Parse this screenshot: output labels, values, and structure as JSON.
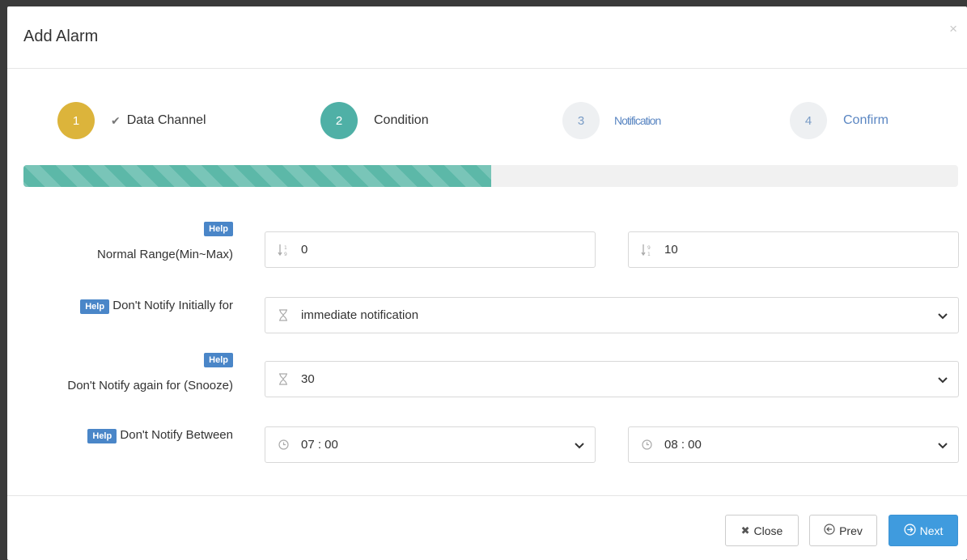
{
  "modal": {
    "title": "Add Alarm",
    "close_glyph": "×"
  },
  "steps": [
    {
      "number": "1",
      "label": "Data Channel",
      "state": "done",
      "color": "#dcb43b",
      "check": "✔"
    },
    {
      "number": "2",
      "label": "Condition",
      "state": "active",
      "color": "#4fb0a6"
    },
    {
      "number": "3",
      "label": "Notification",
      "state": "inactive"
    },
    {
      "number": "4",
      "label": "Confirm",
      "state": "inactive"
    }
  ],
  "progress": {
    "percent": 50,
    "color": "#5cb8a8"
  },
  "form": {
    "help_label": "Help",
    "normal_range": {
      "label": "Normal Range(Min~Max)",
      "min_value": "0",
      "min_icon": "sort-numeric-asc-icon",
      "max_value": "10",
      "max_icon": "sort-numeric-desc-icon"
    },
    "initial_delay": {
      "label": "Don't Notify Initially for",
      "value": "immediate notification",
      "icon": "hourglass-icon"
    },
    "snooze": {
      "label": "Don't Notify again for (Snooze)",
      "value": "30",
      "icon": "hourglass-icon"
    },
    "quiet_hours": {
      "label": "Don't Notify Between",
      "start": "07 : 00",
      "end": "08 : 00",
      "icon": "clock-icon"
    }
  },
  "footer": {
    "close_label": "Close",
    "close_icon": "✖",
    "prev_label": "Prev",
    "prev_icon": "⊖",
    "next_label": "Next",
    "next_icon": "⊖"
  },
  "colors": {
    "accent": "#3f9bde",
    "help": "#4a86c8"
  }
}
